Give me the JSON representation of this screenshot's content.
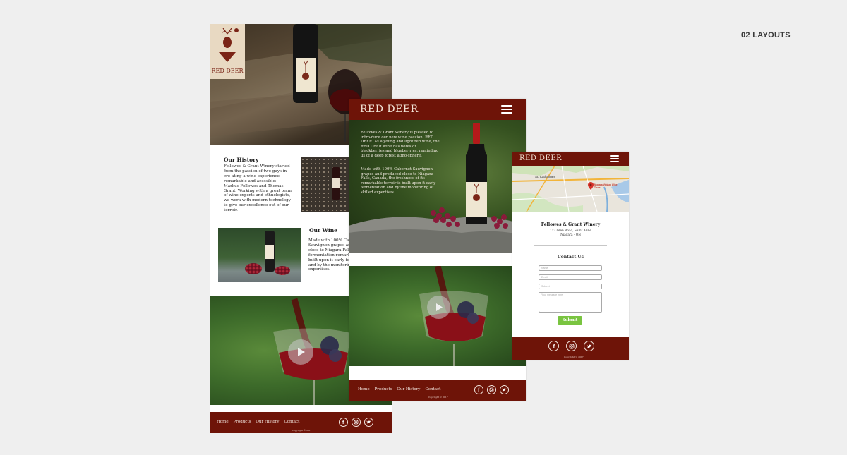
{
  "section_tag": "02 LAYOUTS",
  "brand": {
    "name": "RED DEER",
    "logo_text": "RED DEER"
  },
  "desktop": {
    "history": {
      "title": "Our History",
      "text": "Fellowes & Grant Winery started from the passion of two guys in cre-ating a wine experience remarkable and acessible: Markus Fellowes and Thomas Grant. Working with a great team of wine experts and ethnologists, we work with modern technology to give our excellence out of our terroir."
    },
    "wine": {
      "title": "Our Wine",
      "text": "Made with 100% Cabernet Sauvignon grapes and produced close to Niagara Falls, Canada, the fermentation remarkable terroir is built upon it early fermentation and by the monitoring of skilled expertises."
    },
    "footer": {
      "nav": [
        "Home",
        "Products",
        "Our History",
        "Contact"
      ],
      "copyright": "Copyright © 2017"
    }
  },
  "tablet": {
    "intro_p1": "Fellowes & Grant Winery is pleased to intro-duce our new wine passion: RED DEER. As a young and light red wine, the RED DEER wine has notes of blackberries and blueber-ries, reminding us of a deep forest atmo-sphere.",
    "intro_p2": "Made with 100% Cabernet Sauvignon grapes and produced close to Niagara Falls, Canada, the freshness of its remarkable terroir is built upon it early fermentation and by the monitoring of skilled expertises.",
    "footer": {
      "nav": [
        "Home",
        "Products",
        "Our History",
        "Contact"
      ],
      "copyright": "Copyright © 2017"
    }
  },
  "mobile": {
    "map_labels": {
      "city": "St. Catharines",
      "pin": "Niagara Vintage Wine Tours"
    },
    "company": "Fellowes & Grant Winery",
    "address_line1": "112 Glen Road, Saint Anne",
    "address_line2": "Niagara - ON",
    "contact_title": "Contact Us",
    "form": {
      "name": "Name",
      "email": "Email",
      "subject": "Subject",
      "message": "Your message here",
      "submit": "Submit"
    },
    "copyright": "Copyright © 2017"
  },
  "icons": [
    "facebook-icon",
    "instagram-icon",
    "twitter-icon",
    "menu-icon",
    "play-icon",
    "map-pin-icon"
  ],
  "colors": {
    "maroon": "#6e1408",
    "submit_green": "#79c440",
    "background": "#efefef"
  }
}
